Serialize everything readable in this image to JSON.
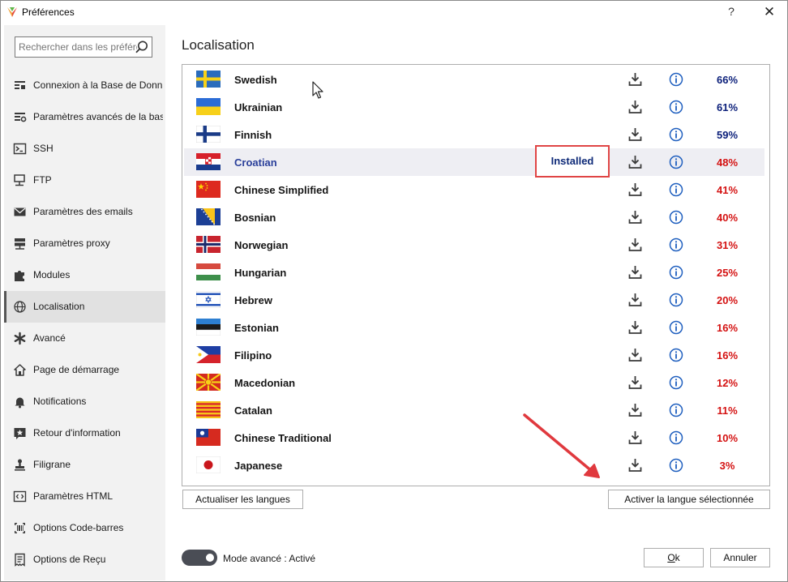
{
  "window": {
    "title": "Préférences",
    "help_label": "?",
    "close_label": "✕"
  },
  "search": {
    "placeholder": "Rechercher dans les préférences"
  },
  "sidebar": {
    "items": [
      {
        "label": "Connexion à la Base de Données",
        "icon": "database-icon"
      },
      {
        "label": "Paramètres avancés de la base de données",
        "icon": "database-settings-icon"
      },
      {
        "label": "SSH",
        "icon": "terminal-icon"
      },
      {
        "label": "FTP",
        "icon": "network-upload-icon"
      },
      {
        "label": "Paramètres des emails",
        "icon": "envelope-icon"
      },
      {
        "label": "Paramètres proxy",
        "icon": "server-icon"
      },
      {
        "label": "Modules",
        "icon": "puzzle-icon"
      },
      {
        "label": "Localisation",
        "icon": "globe-icon",
        "active": true
      },
      {
        "label": "Avancé",
        "icon": "asterisk-icon"
      },
      {
        "label": "Page de démarrage",
        "icon": "home-icon"
      },
      {
        "label": "Notifications",
        "icon": "bell-icon"
      },
      {
        "label": "Retour d'information",
        "icon": "feedback-star-icon"
      },
      {
        "label": "Filigrane",
        "icon": "stamp-icon"
      },
      {
        "label": "Paramètres HTML",
        "icon": "html-code-icon"
      },
      {
        "label": "Options Code-barres",
        "icon": "barcode-icon"
      },
      {
        "label": "Options de Reçu",
        "icon": "receipt-icon"
      }
    ]
  },
  "main": {
    "title": "Localisation",
    "installed_label": "Installed",
    "languages": [
      {
        "name": "Swedish",
        "percent": "66%",
        "flag": "swedish-flag-icon",
        "level": "high"
      },
      {
        "name": "Ukrainian",
        "percent": "61%",
        "flag": "ukrainian-flag-icon",
        "level": "high"
      },
      {
        "name": "Finnish",
        "percent": "59%",
        "flag": "finnish-flag-icon",
        "level": "high"
      },
      {
        "name": "Croatian",
        "percent": "48%",
        "flag": "croatian-flag-icon",
        "level": "low",
        "installed": true,
        "selected": true
      },
      {
        "name": "Chinese Simplified",
        "percent": "41%",
        "flag": "chinese-flag-icon",
        "level": "low"
      },
      {
        "name": "Bosnian",
        "percent": "40%",
        "flag": "bosnian-flag-icon",
        "level": "low"
      },
      {
        "name": "Norwegian",
        "percent": "31%",
        "flag": "norwegian-flag-icon",
        "level": "low"
      },
      {
        "name": "Hungarian",
        "percent": "25%",
        "flag": "hungarian-flag-icon",
        "level": "low"
      },
      {
        "name": "Hebrew",
        "percent": "20%",
        "flag": "israeli-flag-icon",
        "level": "low"
      },
      {
        "name": "Estonian",
        "percent": "16%",
        "flag": "estonian-flag-icon",
        "level": "low"
      },
      {
        "name": "Filipino",
        "percent": "16%",
        "flag": "philippine-flag-icon",
        "level": "low"
      },
      {
        "name": "Macedonian",
        "percent": "12%",
        "flag": "macedonian-flag-icon",
        "level": "low"
      },
      {
        "name": "Catalan",
        "percent": "11%",
        "flag": "catalan-flag-icon",
        "level": "low"
      },
      {
        "name": "Chinese Traditional",
        "percent": "10%",
        "flag": "taiwanese-flag-icon",
        "level": "low"
      },
      {
        "name": "Japanese",
        "percent": "3%",
        "flag": "japanese-flag-icon",
        "level": "low"
      }
    ],
    "refresh_button": "Actualiser les langues",
    "activate_button": "Activer la langue sélectionnée"
  },
  "footer": {
    "advanced_mode_label": "Mode avancé : Activé",
    "advanced_mode_on": true,
    "ok_prefix": "",
    "ok_underlined": "O",
    "ok_rest": "k",
    "cancel_label": "Annuler"
  },
  "colors": {
    "percent_high": "#0b1f7a",
    "percent_low": "#d41212",
    "installed_border": "#e04545",
    "selected_row": "#eeeef3",
    "icon_blue": "#1f5fbf",
    "annotation_arrow": "#e0393e"
  }
}
